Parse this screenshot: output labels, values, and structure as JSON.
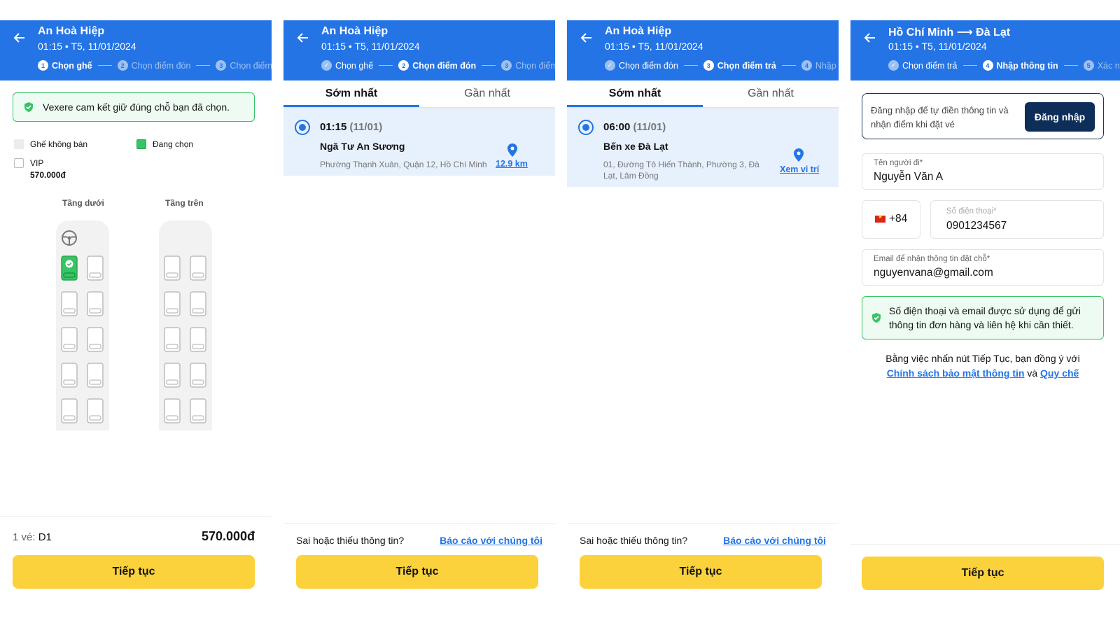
{
  "colors": {
    "primary": "#2474e5",
    "accent": "#fcd23c",
    "success": "#37c464",
    "navy": "#0d2e59"
  },
  "icons": [
    "arrow-left-icon",
    "check-shield-icon",
    "steering-wheel-icon",
    "seat-icon",
    "map-pin-icon",
    "vietnam-flag-icon"
  ],
  "screen1": {
    "header": {
      "title": "An Hoà Hiệp",
      "subtitle": "01:15 • T5, 11/01/2024"
    },
    "steps": [
      "Chọn ghế",
      "Chọn điểm đón",
      "Chọn điểm"
    ],
    "step_nums": [
      "1",
      "2",
      "3"
    ],
    "commit": "Vexere cam kết giữ đúng chỗ bạn đã chọn.",
    "legend": {
      "unavailable": "Ghế không bán",
      "selected": "Đang chọn",
      "vip": "VIP",
      "vip_price": "570.000đ"
    },
    "deck_lower": "Tầng dưới",
    "deck_upper": "Tầng trên",
    "ticket_label": "1 vé:",
    "ticket_seat": "D1",
    "total": "570.000đ",
    "continue": "Tiếp tục"
  },
  "screen2": {
    "header": {
      "title": "An Hoà Hiệp",
      "subtitle": "01:15 • T5, 11/01/2024"
    },
    "steps": [
      "Chọn ghế",
      "Chọn điểm đón",
      "Chọn điểm"
    ],
    "step_nums": [
      "",
      "2",
      "3"
    ],
    "tabs": [
      "Sớm nhất",
      "Gần nhất"
    ],
    "point": {
      "time": "01:15",
      "date": "(11/01)",
      "name": "Ngã Tư An Sương",
      "address": "Phường Thạnh Xuân, Quận 12, Hồ Chí Minh",
      "link": "12.9 km"
    },
    "report_q": "Sai hoặc thiếu thông tin?",
    "report_link": "Báo cáo với chúng tôi",
    "continue": "Tiếp tục"
  },
  "screen3": {
    "header": {
      "title": "An Hoà Hiệp",
      "subtitle": "01:15 • T5, 11/01/2024"
    },
    "steps": [
      "Chọn điểm đón",
      "Chọn điểm trả",
      "Nhập"
    ],
    "step_nums": [
      "",
      "3",
      "4"
    ],
    "tabs": [
      "Sớm nhất",
      "Gần nhất"
    ],
    "point": {
      "time": "06:00",
      "date": "(11/01)",
      "name": "Bến xe Đà Lạt",
      "address": "01, Đường Tô Hiến Thành, Phường 3, Đà Lạt, Lâm Đồng",
      "link": "Xem vị trí"
    },
    "report_q": "Sai hoặc thiếu thông tin?",
    "report_link": "Báo cáo với chúng tôi",
    "continue": "Tiếp tục"
  },
  "screen4": {
    "header": {
      "title": "Hồ Chí Minh ⟶ Đà Lạt",
      "subtitle": "01:15 • T5, 11/01/2024"
    },
    "steps": [
      "Chọn điểm trả",
      "Nhập thông tin",
      "Xác nh"
    ],
    "step_nums": [
      "",
      "4",
      "5"
    ],
    "login_text": "Đăng nhập để tự điền thông tin và nhận điểm khi đặt vé",
    "login_button": "Đăng nhập",
    "name_label": "Tên người đi*",
    "name_value": "Nguyễn Văn A",
    "country_code": "+84",
    "phone_label": "Số điện thoại*",
    "phone_value": "0901234567",
    "email_label": "Email để nhận thông tin đặt chỗ*",
    "email_value": "nguyenvana@gmail.com",
    "note": "Số điện thoại và email được sử dụng để gửi thông tin đơn hàng và liên hệ khi cần thiết.",
    "policy_text": "Bằng việc nhấn nút Tiếp Tục, bạn đồng ý với",
    "policy_link": "Chính sách bảo mật thông tin",
    "policy_and": "và",
    "rules_link": "Quy chế",
    "continue": "Tiếp tục"
  }
}
